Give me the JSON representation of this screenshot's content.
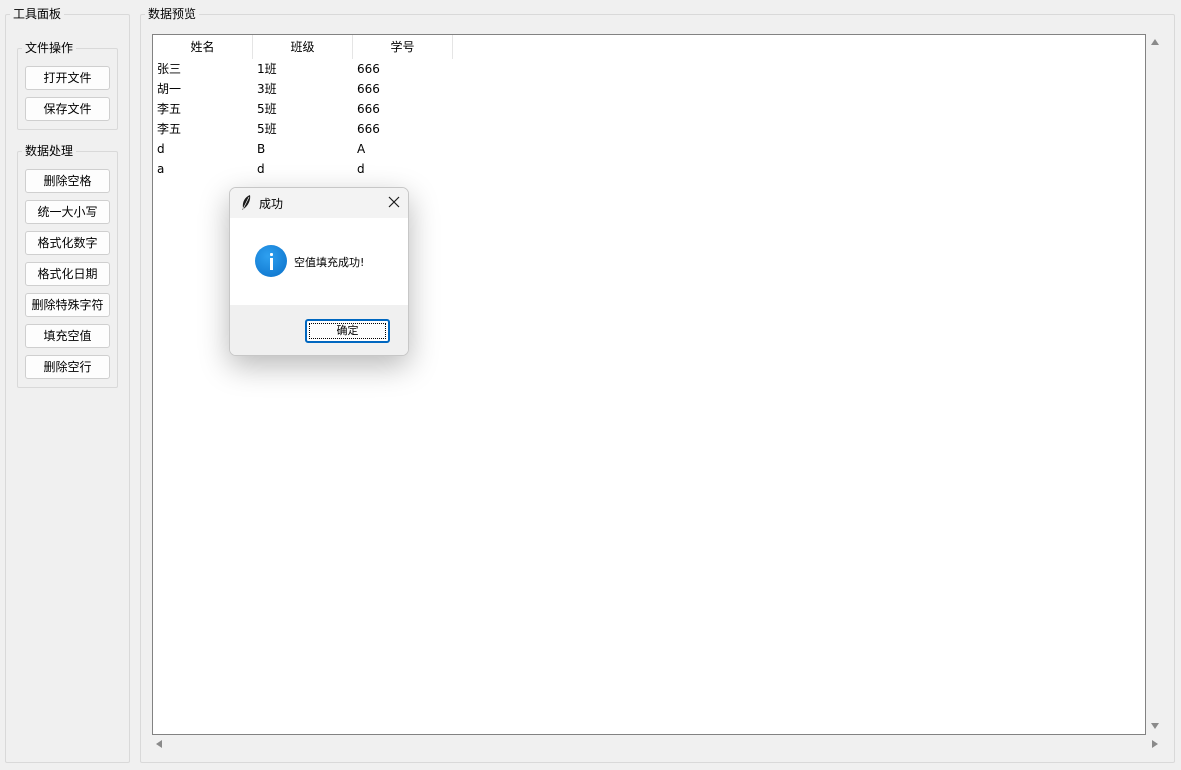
{
  "tool_panel": {
    "title": "工具面板",
    "file_ops": {
      "title": "文件操作",
      "buttons": [
        "打开文件",
        "保存文件"
      ]
    },
    "data_processing": {
      "title": "数据处理",
      "buttons": [
        "删除空格",
        "统一大小写",
        "格式化数字",
        "格式化日期",
        "删除特殊字符",
        "填充空值",
        "删除空行"
      ]
    }
  },
  "preview": {
    "title": "数据预览",
    "columns": [
      "姓名",
      "班级",
      "学号"
    ],
    "rows": [
      [
        "张三",
        "1班",
        "666"
      ],
      [
        "胡一",
        "3班",
        "666"
      ],
      [
        "李五",
        "5班",
        "666"
      ],
      [
        "李五",
        "5班",
        "666"
      ],
      [
        "d",
        "B",
        "A"
      ],
      [
        "a",
        "d",
        "d"
      ]
    ]
  },
  "dialog": {
    "title": "成功",
    "message": "空值填充成功!",
    "ok_label": "确定",
    "icon": "info-icon",
    "title_icon": "feather-icon"
  }
}
